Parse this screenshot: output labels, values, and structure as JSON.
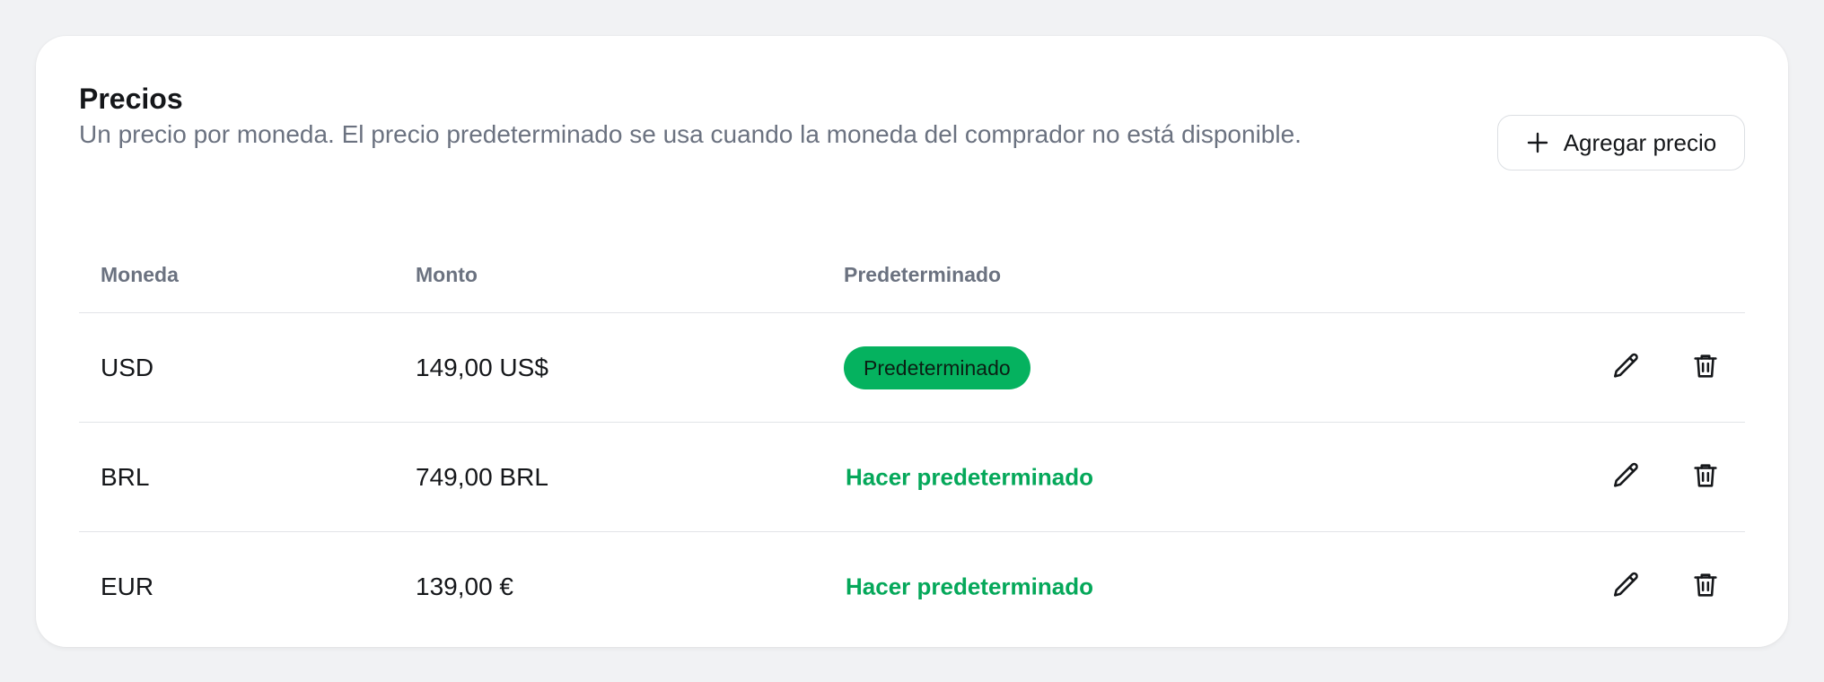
{
  "pricing": {
    "title": "Precios",
    "subtitle": "Un precio por moneda. El precio predeterminado se usa cuando la moneda del comprador no está disponible.",
    "add_button_label": "Agregar precio",
    "columns": {
      "currency": "Moneda",
      "amount": "Monto",
      "default": "Predeterminado"
    },
    "rows": [
      {
        "currency": "USD",
        "amount": "149,00 US$",
        "default_badge": "Predeterminado"
      },
      {
        "currency": "BRL",
        "amount": "749,00 BRL",
        "make_default": "Hacer predeterminado"
      },
      {
        "currency": "EUR",
        "amount": "139,00 €",
        "make_default": "Hacer predeterminado"
      }
    ]
  },
  "icons": {
    "add": "plus-icon",
    "edit": "pencil-icon",
    "delete": "trash-icon"
  },
  "colors": {
    "accent_green": "#05b25f",
    "link_green": "#05a85a",
    "muted_text": "#6b7280",
    "divider": "#e2e4e8"
  }
}
